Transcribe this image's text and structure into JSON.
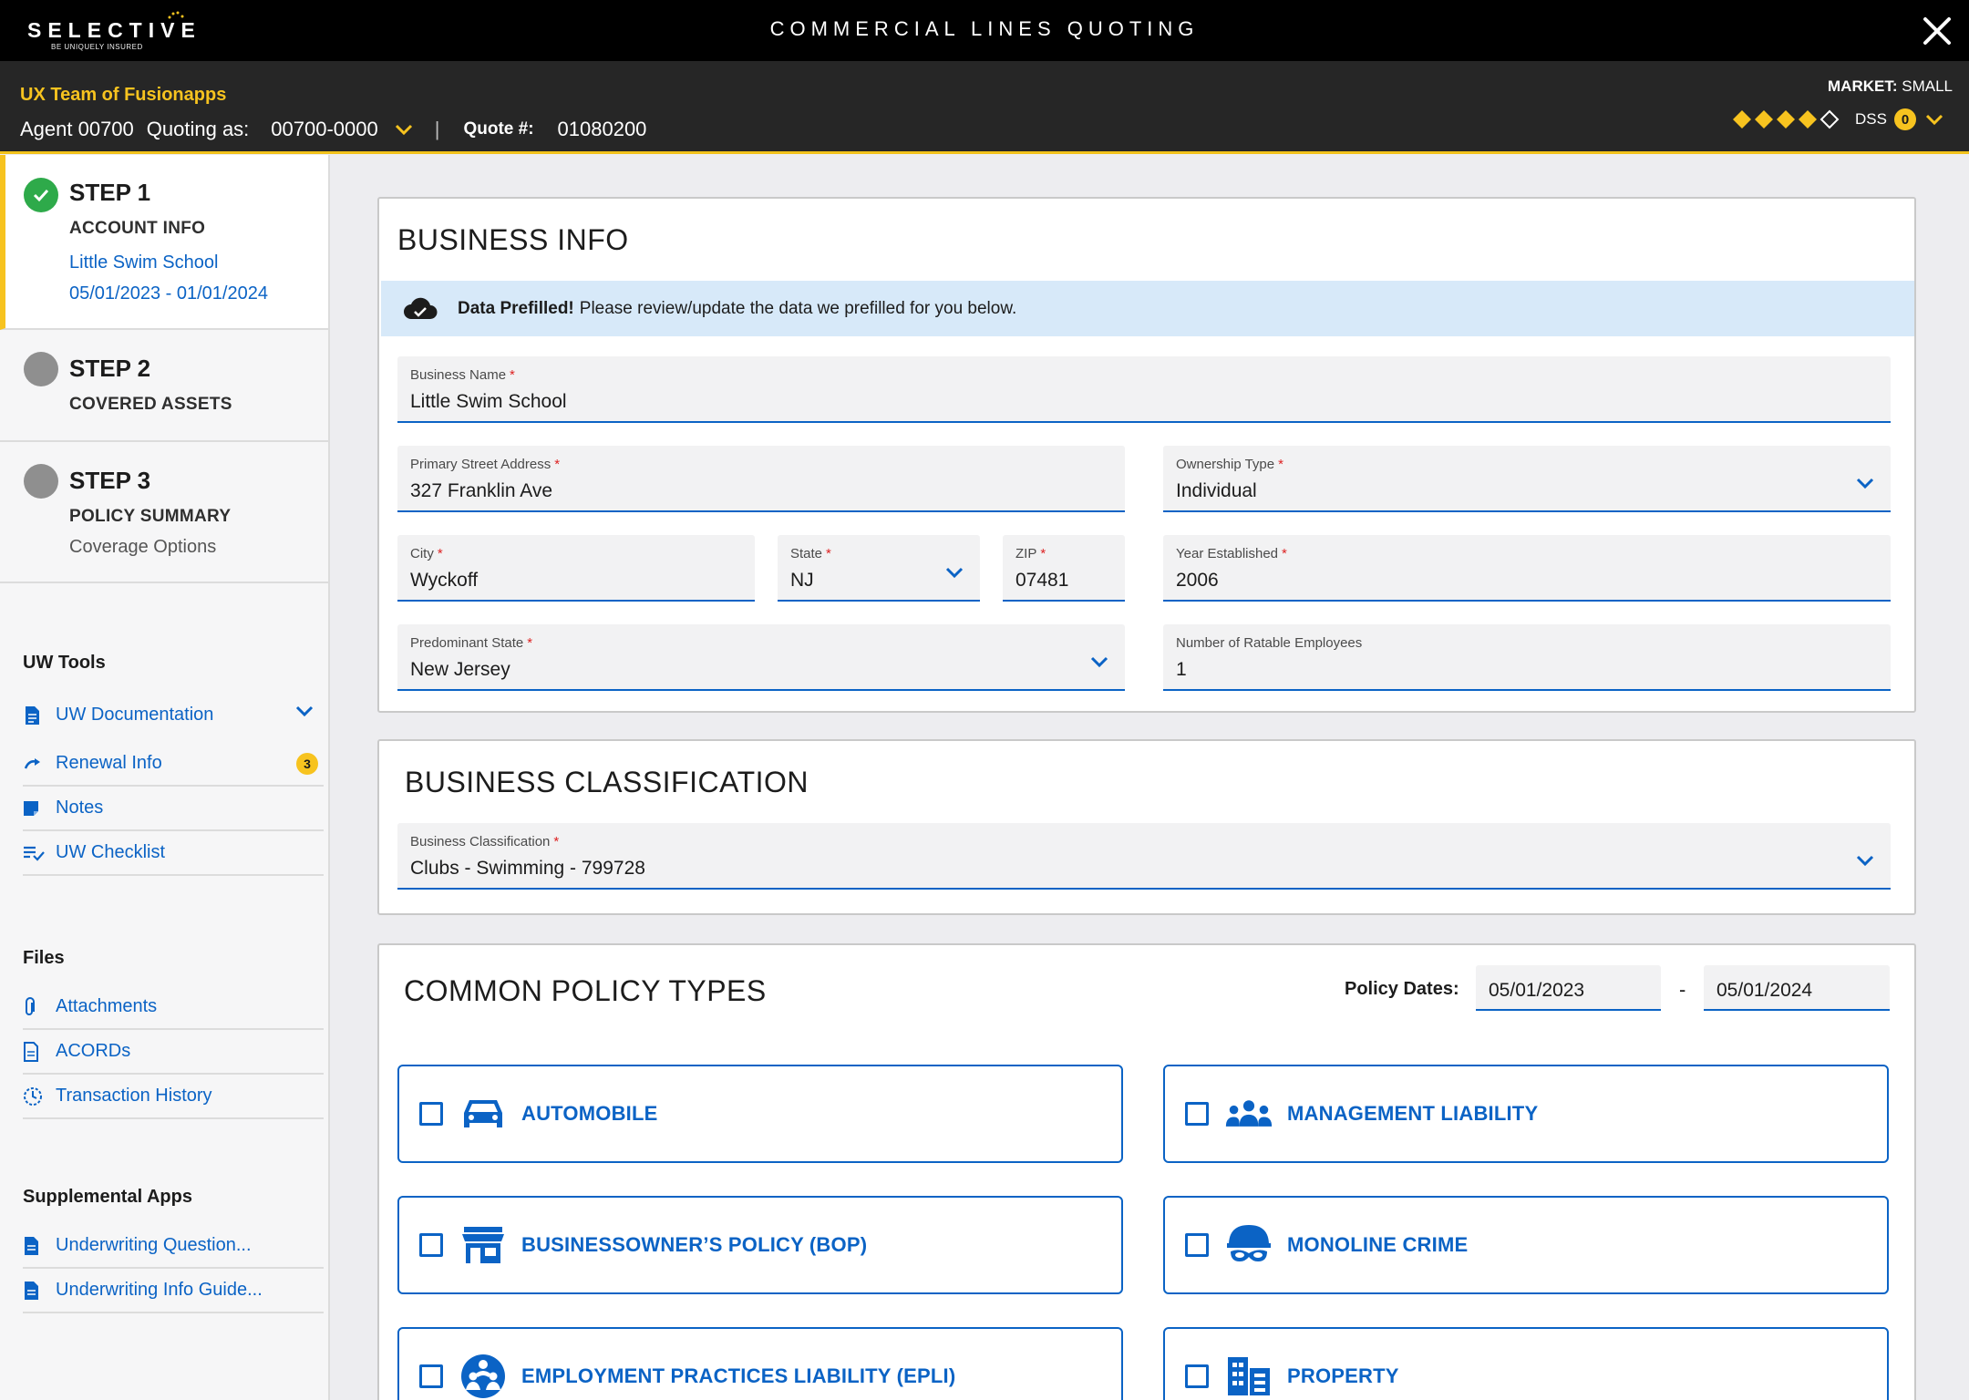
{
  "topbar": {
    "logo_text": "SELECTIVE",
    "logo_tagline": "BE UNIQUELY INSURED",
    "app_title": "COMMERCIAL LINES QUOTING"
  },
  "header": {
    "team": "UX Team of Fusionapps",
    "agent": "Agent 00700",
    "quoting_as_label": "Quoting as:",
    "quoting_as_value": "00700-0000",
    "separator": "|",
    "quote_label": "Quote #:",
    "quote_number": "01080200",
    "market_label": "MARKET:",
    "market_value": "SMALL",
    "dss_label": "DSS",
    "dss_count": "0",
    "diamond_rating": 4,
    "diamond_total": 5
  },
  "steps": [
    {
      "title": "STEP 1",
      "subtitle": "ACCOUNT INFO",
      "account": "Little Swim School",
      "dates": "05/01/2023 - 01/01/2024",
      "status": "complete"
    },
    {
      "title": "STEP 2",
      "subtitle": "COVERED ASSETS",
      "status": "pending"
    },
    {
      "title": "STEP 3",
      "subtitle": "POLICY SUMMARY",
      "detail": "Coverage Options",
      "status": "pending"
    }
  ],
  "uw_tools": {
    "heading": "UW Tools",
    "items": [
      {
        "label": "UW Documentation",
        "icon": "document-icon"
      },
      {
        "label": "Renewal Info",
        "icon": "renew-icon",
        "badge": "3"
      },
      {
        "label": "Notes",
        "icon": "note-icon"
      },
      {
        "label": "UW Checklist",
        "icon": "checklist-icon"
      }
    ]
  },
  "files": {
    "heading": "Files",
    "items": [
      {
        "label": "Attachments",
        "icon": "paperclip-icon"
      },
      {
        "label": "ACORDs",
        "icon": "acord-icon"
      },
      {
        "label": "Transaction History",
        "icon": "history-icon"
      }
    ]
  },
  "supplemental": {
    "heading": "Supplemental Apps",
    "items": [
      {
        "label": "Underwriting Question...",
        "icon": "document-icon"
      },
      {
        "label": "Underwriting Info Guide...",
        "icon": "document-icon"
      }
    ]
  },
  "business_info": {
    "title": "BUSINESS INFO",
    "banner_bold": "Data Prefilled!",
    "banner_text": "Please review/update the data we prefilled for you below.",
    "fields": {
      "business_name": {
        "label": "Business Name",
        "value": "Little Swim School"
      },
      "street": {
        "label": "Primary Street Address",
        "value": "327 Franklin Ave"
      },
      "ownership": {
        "label": "Ownership Type",
        "value": "Individual"
      },
      "city": {
        "label": "City",
        "value": "Wyckoff"
      },
      "state": {
        "label": "State",
        "value": "NJ"
      },
      "zip": {
        "label": "ZIP",
        "value": "07481"
      },
      "year": {
        "label": "Year Established",
        "value": "2006"
      },
      "pred_state": {
        "label": "Predominant State",
        "value": "New Jersey"
      },
      "employees": {
        "label": "Number of Ratable Employees",
        "value": "1"
      }
    }
  },
  "business_classification": {
    "title": "BUSINESS CLASSIFICATION",
    "label": "Business Classification",
    "value": "Clubs - Swimming - 799728"
  },
  "policy_types": {
    "title": "COMMON POLICY TYPES",
    "dates_label": "Policy Dates:",
    "start_date": "05/01/2023",
    "date_separator": "-",
    "end_date": "05/01/2024",
    "items": [
      {
        "label": "AUTOMOBILE",
        "icon": "car-icon"
      },
      {
        "label": "MANAGEMENT LIABILITY",
        "icon": "people-icon"
      },
      {
        "label": "BUSINESSOWNER’S POLICY (BOP)",
        "icon": "storefront-icon"
      },
      {
        "label": "MONOLINE CRIME",
        "icon": "burglar-icon"
      },
      {
        "label": "EMPLOYMENT PRACTICES LIABILITY (EPLI)",
        "icon": "employees-icon"
      },
      {
        "label": "PROPERTY",
        "icon": "building-icon"
      }
    ]
  },
  "colors": {
    "accent_blue": "#0b63c5",
    "brand_yellow": "#f7c31f",
    "success_green": "#2eaa4a"
  }
}
